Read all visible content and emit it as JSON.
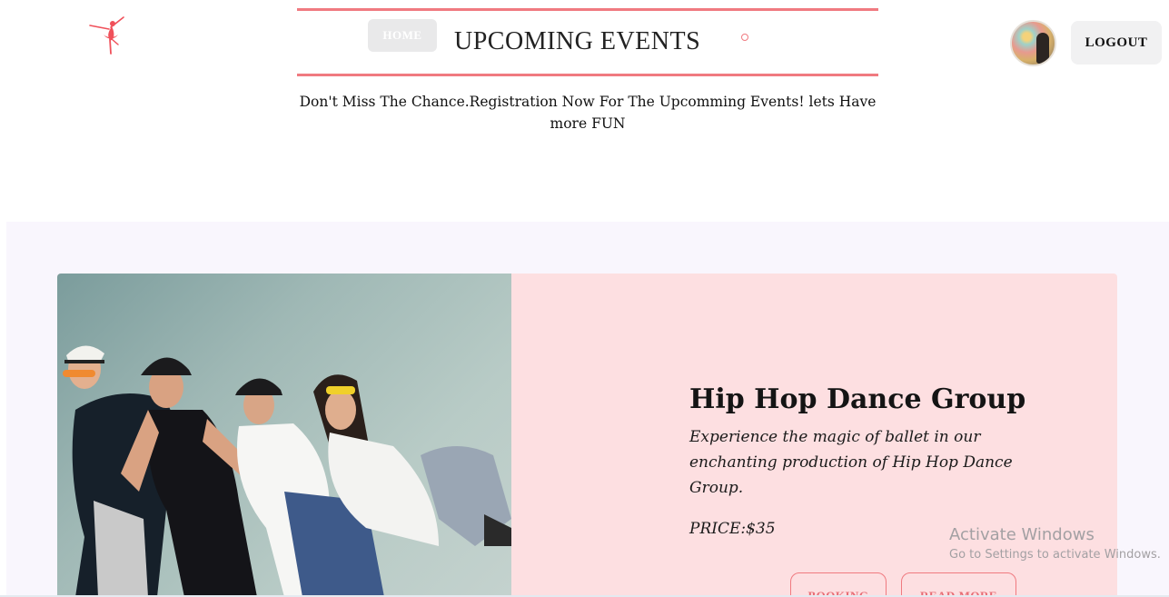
{
  "header": {
    "logo_icon": "ballerina-logo-icon",
    "home_label": "HOME",
    "page_title": "UPCOMING EVENTS",
    "logout_label": "LOGOUT",
    "accent_color": "#f07a80"
  },
  "tagline": "Don't Miss The Chance.Registration Now For The Upcomming Events! lets Have more FUN",
  "event": {
    "title": "Hip Hop Dance Group",
    "description": "Experience the magic of ballet in our enchanting production of Hip Hop Dance Group.",
    "price": "PRICE:$35",
    "booking_label": "BOOKING",
    "read_more_label": "READ MORE",
    "card_color": "#fddfe1"
  },
  "watermark": {
    "title": "Activate Windows",
    "subtitle": "Go to Settings to activate Windows."
  }
}
